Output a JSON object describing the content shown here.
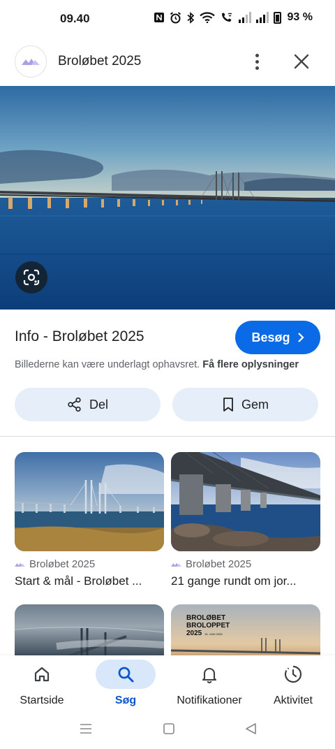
{
  "status_bar": {
    "time": "09.40",
    "battery": "93 %",
    "icons": [
      "nfc-icon",
      "alarm-icon",
      "bluetooth-icon",
      "wifi-icon",
      "wifi-calling-icon",
      "signal-icon",
      "signal-icon",
      "battery-icon"
    ]
  },
  "header": {
    "title": "Broløbet 2025",
    "logo_icon": "mountain-logo-icon",
    "more_icon": "more-vert-icon",
    "close_icon": "close-icon"
  },
  "hero": {
    "lens_icon": "google-lens-icon"
  },
  "info": {
    "title": "Info - Broløbet 2025",
    "visit_label": "Besøg",
    "copyright_text": "Billederne kan være underlagt ophavsret.",
    "copyright_link": "Få flere oplysninger",
    "share_label": "Del",
    "save_label": "Gem"
  },
  "results": [
    {
      "source": "Broløbet 2025",
      "caption": "Start & mål - Broløbet ..."
    },
    {
      "source": "Broløbet 2025",
      "caption": "21 gange rundt om jor..."
    }
  ],
  "partial_thumb": {
    "line1": "BROLØBET",
    "line2": "BROLOPPET",
    "line3": "2025",
    "date": "15. JUNI 2025"
  },
  "bottom_nav": [
    {
      "label": "Startside",
      "icon": "home-icon",
      "active": false
    },
    {
      "label": "Søg",
      "icon": "search-icon",
      "active": true
    },
    {
      "label": "Notifikationer",
      "icon": "bell-icon",
      "active": false
    },
    {
      "label": "Aktivitet",
      "icon": "activity-icon",
      "active": false
    }
  ],
  "colors": {
    "accent": "#0b6ae6",
    "pill_bg": "#e6eef9",
    "nav_active_bg": "#d9e7fb",
    "nav_active_text": "#0b57d0"
  }
}
